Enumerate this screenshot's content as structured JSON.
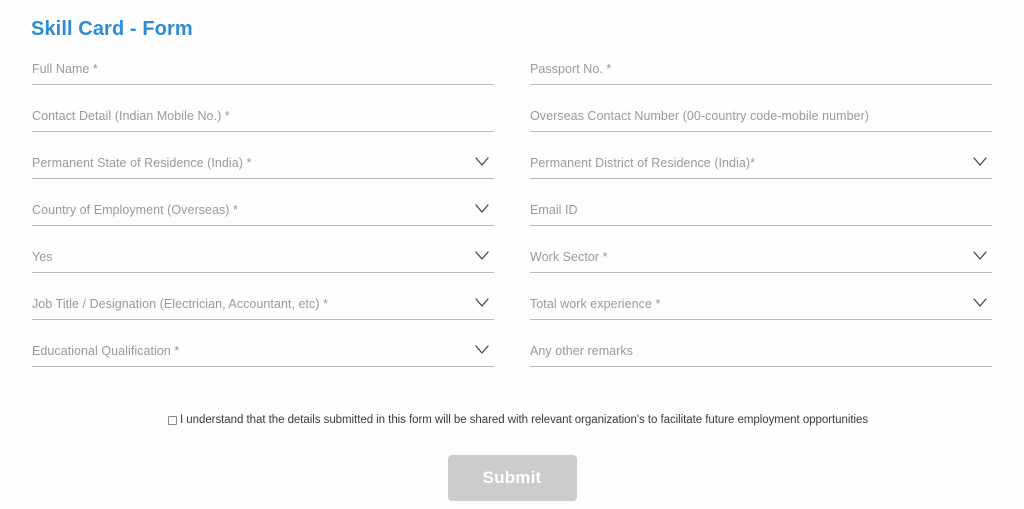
{
  "page": {
    "background_color": "#fdfdfd",
    "title": "Skill Card - Form",
    "title_color": "#2e8bd4"
  },
  "form": {
    "label_color": "#9a9a9a",
    "underline_color": "#b9b9b9",
    "fields": [
      {
        "label": "Full Name *",
        "type": "text",
        "column": "left",
        "row": 0,
        "has_chevron": false
      },
      {
        "label": "Passport No. *",
        "type": "text",
        "column": "right",
        "row": 0,
        "has_chevron": false
      },
      {
        "label": "Contact Detail (Indian Mobile No.) *",
        "type": "text",
        "column": "left",
        "row": 1,
        "has_chevron": false
      },
      {
        "label": "Overseas Contact Number (00-country code-mobile number)",
        "type": "text",
        "column": "right",
        "row": 1,
        "has_chevron": false
      },
      {
        "label": "Permanent State of Residence (India) *",
        "type": "select",
        "column": "left",
        "row": 2,
        "has_chevron": true
      },
      {
        "label": "Permanent District of Residence (India)*",
        "type": "select",
        "column": "right",
        "row": 2,
        "has_chevron": true
      },
      {
        "label": "Country of Employment (Overseas) *",
        "type": "select",
        "column": "left",
        "row": 3,
        "has_chevron": true
      },
      {
        "label": "Email ID",
        "type": "text",
        "column": "right",
        "row": 3,
        "has_chevron": false
      },
      {
        "label": "Yes",
        "type": "select",
        "column": "left",
        "row": 4,
        "has_chevron": true
      },
      {
        "label": "Work Sector *",
        "type": "select",
        "column": "right",
        "row": 4,
        "has_chevron": true
      },
      {
        "label": "Job Title / Designation (Electrician, Accountant, etc) *",
        "type": "select",
        "column": "left",
        "row": 5,
        "has_chevron": true
      },
      {
        "label": "Total work experience *",
        "type": "select",
        "column": "right",
        "row": 5,
        "has_chevron": true
      },
      {
        "label": "Educational Qualification *",
        "type": "select",
        "column": "left",
        "row": 6,
        "has_chevron": true
      },
      {
        "label": "Any other remarks",
        "type": "text",
        "column": "right",
        "row": 6,
        "has_chevron": false
      }
    ]
  },
  "consent": {
    "checked": false,
    "text": "I understand that the details submitted in this form will be shared with relevant organization's to facilitate future employment opportunities"
  },
  "submit": {
    "label": "Submit",
    "background_color": "#cccccc",
    "text_color": "#ffffff",
    "enabled": false
  }
}
